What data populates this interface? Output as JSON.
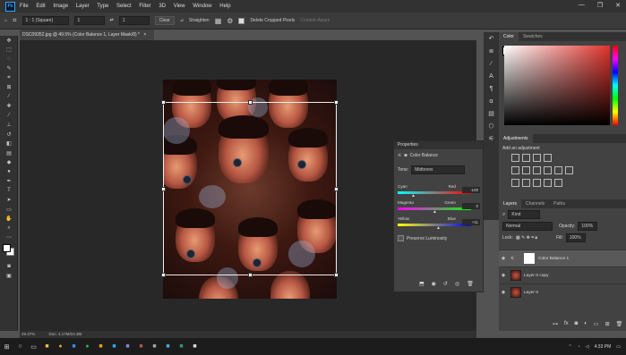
{
  "menubar": {
    "logo": "Ps",
    "items": [
      "File",
      "Edit",
      "Image",
      "Layer",
      "Type",
      "Select",
      "Filter",
      "3D",
      "View",
      "Window",
      "Help"
    ],
    "window_controls": [
      "—",
      "❐",
      "✕"
    ]
  },
  "options": {
    "ratio_value": "1 : 1 (Square)",
    "ratio_w": "1",
    "ratio_h": "1",
    "clear_label": "Clear",
    "straighten_label": "Straighten",
    "delete_cropped_label": "Delete Cropped Pixels",
    "content_aware_label": "Content-Aware"
  },
  "document": {
    "tab_title": "DSC09352.jpg @ 49.5% (Color Balance 1, Layer Mask/8) *",
    "tab_close": "×",
    "zoom": "49.47%",
    "doc_info": "Doc: 4.17M/24.3M"
  },
  "color_panel": {
    "tabs": [
      "Color",
      "Swatches"
    ]
  },
  "adjustments": {
    "tabs": [
      "Adjustments"
    ],
    "hint": "Add an adjustment"
  },
  "properties": {
    "title": "Properties",
    "adj_name": "Color Balance",
    "tone_label": "Tone:",
    "tone_value": "Midtones",
    "rows": [
      {
        "left": "Cyan",
        "right": "Red",
        "value": "-100",
        "pos": 0.22
      },
      {
        "left": "Magenta",
        "right": "Green",
        "value": "0",
        "pos": 0.5
      },
      {
        "left": "Yellow",
        "right": "Blue",
        "value": "+11",
        "pos": 0.55
      }
    ],
    "preserve_label": "Preserve Luminosity"
  },
  "layers": {
    "tabs": [
      "Layers",
      "Channels",
      "Paths"
    ],
    "kind_label": "Kind",
    "blend_mode": "Normal",
    "opacity_label": "Opacity:",
    "opacity_value": "100%",
    "lock_label": "Lock:",
    "fill_label": "Fill:",
    "fill_value": "100%",
    "items": [
      {
        "name": "Color Balance 1",
        "selected": true,
        "type": "adjustment"
      },
      {
        "name": "Layer 0 copy",
        "selected": false,
        "type": "image"
      },
      {
        "name": "Layer 0",
        "selected": false,
        "type": "image"
      }
    ]
  },
  "taskbar": {
    "time": "4:33 PM"
  },
  "colors": {
    "accent": "#31a8ff",
    "panel": "#424242",
    "bg": "#535353"
  }
}
